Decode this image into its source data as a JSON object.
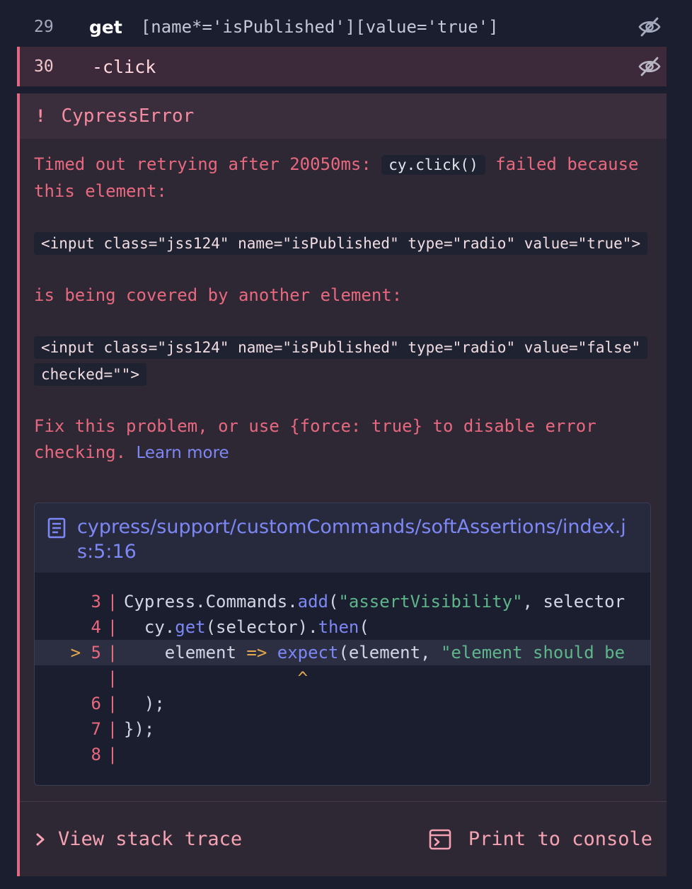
{
  "commands": [
    {
      "number": "29",
      "name": "get",
      "message": "[name*='isPublished'][value='true']",
      "state": "passed"
    },
    {
      "number": "30",
      "name": "-click",
      "message": "",
      "state": "failed"
    }
  ],
  "error": {
    "title": "CypressError",
    "icon": "exclamation-icon",
    "message_pre": "Timed out retrying after 20050ms:",
    "message_code": "cy.click()",
    "message_post": "failed because this element:",
    "element_html": "<input class=\"jss124\" name=\"isPublished\" type=\"radio\" value=\"true\">",
    "covered_text": "is being covered by another element:",
    "covering_html": "<input class=\"jss124\" name=\"isPublished\" type=\"radio\" value=\"false\" checked=\"\">",
    "fix_text": "Fix this problem, or use {force: true} to disable error checking.",
    "learn_more_label": "Learn more",
    "code_frame": {
      "file_path": "cypress/support/customCommands/softAssertions/index.js:5:16",
      "lines": [
        {
          "num": "3",
          "marker": ""
        },
        {
          "num": "4",
          "marker": ""
        },
        {
          "num": "5",
          "marker": ">"
        },
        {
          "num": "",
          "marker": ""
        },
        {
          "num": "6",
          "marker": ""
        },
        {
          "num": "7",
          "marker": ""
        },
        {
          "num": "8",
          "marker": ""
        }
      ],
      "code": {
        "l3_a": "Cypress.Commands.",
        "l3_fn": "add",
        "l3_b": "(",
        "l3_str": "\"assertVisibility\"",
        "l3_c": ", selector",
        "l4_a": "  cy.",
        "l4_fn1": "get",
        "l4_b": "(selector).",
        "l4_fn2": "then",
        "l4_c": "(",
        "l5_a": "    element ",
        "l5_op": "=>",
        "l5_b": " ",
        "l5_fn": "expect",
        "l5_c": "(element, ",
        "l5_str": "\"element should be",
        "caret_pad": "                 ",
        "caret": "^",
        "l6": "  );",
        "l7": "});",
        "l8": ""
      }
    },
    "stack_trace_label": "View stack trace",
    "print_console_label": "Print to console"
  },
  "colors": {
    "error": "#e8697f",
    "link": "#7d87f5",
    "string": "#5fb58a",
    "operator": "#e6a84c"
  }
}
